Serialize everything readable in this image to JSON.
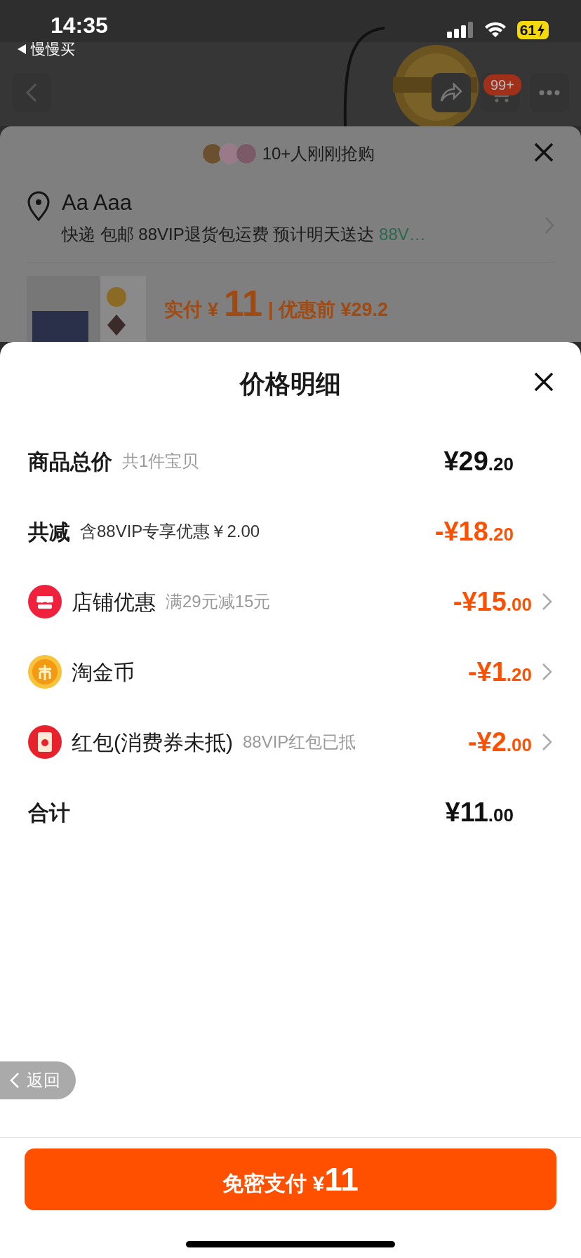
{
  "status_bar": {
    "time": "14:35",
    "back_app": "慢慢买",
    "battery": "61"
  },
  "background": {
    "cart_badge": "99+",
    "buyers": "10+人刚刚抢购",
    "address_name": "Aa Aaa",
    "delivery": "快递 包邮 88VIP退货包运费 预计明天送达",
    "delivery_tag": "88V…",
    "price_label": "实付",
    "price_currency": "¥",
    "price_value": "11",
    "before_price": "| 优惠前 ¥29.2"
  },
  "sheet": {
    "title": "价格明细",
    "rows": [
      {
        "kind": "subtotal",
        "label": "商品总价",
        "note": "共1件宝贝",
        "amount": "¥29",
        "cents": ".20"
      },
      {
        "kind": "reduction",
        "label": "共减",
        "note": "含88VIP专享优惠￥2.00",
        "amount": "-¥18",
        "cents": ".20"
      },
      {
        "kind": "store",
        "label": "店铺优惠",
        "note": "满29元减15元",
        "amount": "-¥15",
        "cents": ".00"
      },
      {
        "kind": "coins",
        "label": "淘金币",
        "amount": "-¥1",
        "cents": ".20"
      },
      {
        "kind": "packet",
        "label": "红包(消费券未抵)",
        "note": "88VIP红包已抵",
        "amount": "-¥2",
        "cents": ".00"
      },
      {
        "kind": "total",
        "label": "合计",
        "amount": "¥11",
        "cents": ".00"
      }
    ],
    "back_pill": "返回",
    "pay_button": {
      "label": "免密支付",
      "currency": "¥",
      "amount": "11"
    }
  }
}
